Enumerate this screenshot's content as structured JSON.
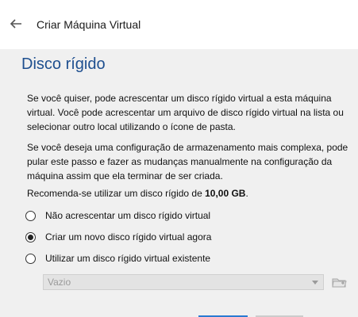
{
  "window": {
    "title": "Criar Máquina Virtual"
  },
  "section": {
    "title": "Disco rígido"
  },
  "paragraphs": {
    "p1": "Se você quiser, pode acrescentar um disco rígido virtual a esta máquina virtual. Você pode acrescentar um arquivo de disco rígido virtual na lista ou selecionar outro local utilizando o ícone de pasta.",
    "p2": "Se você deseja uma configuração de armazenamento mais complexa, pode pular este passo e fazer as mudanças manualmente na configuração da máquina assim que ela terminar de ser criada.",
    "recommend_prefix": "Recomenda-se utilizar um disco rígido de ",
    "recommend_size": "10,00 GB",
    "recommend_suffix": "."
  },
  "options": [
    {
      "label": "Não acrescentar um disco rígido virtual",
      "selected": false
    },
    {
      "label": "Criar um novo disco rígido virtual agora",
      "selected": true
    },
    {
      "label": "Utilizar um disco rígido virtual existente",
      "selected": false
    }
  ],
  "disk_select": {
    "value": "Vazio",
    "enabled": false
  },
  "icons": {
    "back": "back-arrow-icon",
    "folder": "folder-icon"
  },
  "colors": {
    "title_blue": "#1e4f8f",
    "panel_bg": "#f0f0f0",
    "accent": "#2a7ad2"
  }
}
